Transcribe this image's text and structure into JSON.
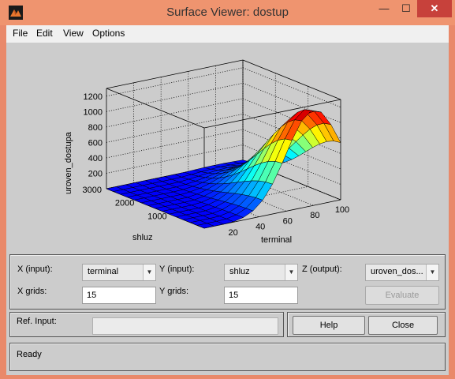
{
  "window": {
    "title": "Surface Viewer: dostup"
  },
  "menu": [
    "File",
    "Edit",
    "View",
    "Options"
  ],
  "chart_data": {
    "type": "surface",
    "zlabel": "uroven_dostupa",
    "xlabel": "terminal",
    "ylabel": "shluz",
    "x_ticks": [
      "20",
      "40",
      "60",
      "80",
      "100"
    ],
    "y_ticks": [
      "1000",
      "2000",
      "3000"
    ],
    "z_ticks": [
      "200",
      "400",
      "600",
      "800",
      "1000",
      "1200"
    ],
    "x_range": [
      0,
      100
    ],
    "y_range": [
      0,
      3000
    ],
    "z_range": [
      0,
      1300
    ],
    "grid": true,
    "colormap": "jet",
    "z_peak": 1250,
    "peak_at": {
      "terminal": 80,
      "shluz": 0
    }
  },
  "controls": {
    "x_input_label": "X (input):",
    "x_input_value": "terminal",
    "y_input_label": "Y (input):",
    "y_input_value": "shluz",
    "z_output_label": "Z (output):",
    "z_output_value": "uroven_dos...",
    "x_grids_label": "X grids:",
    "x_grids_value": "15",
    "y_grids_label": "Y grids:",
    "y_grids_value": "15",
    "evaluate_label": "Evaluate",
    "ref_input_label": "Ref. Input:",
    "ref_input_value": "",
    "help_label": "Help",
    "close_label": "Close",
    "status": "Ready"
  },
  "colors": {
    "titlebar": "#ef946f",
    "figure_bg": "#cccccc",
    "close_button": "#c7413b"
  }
}
